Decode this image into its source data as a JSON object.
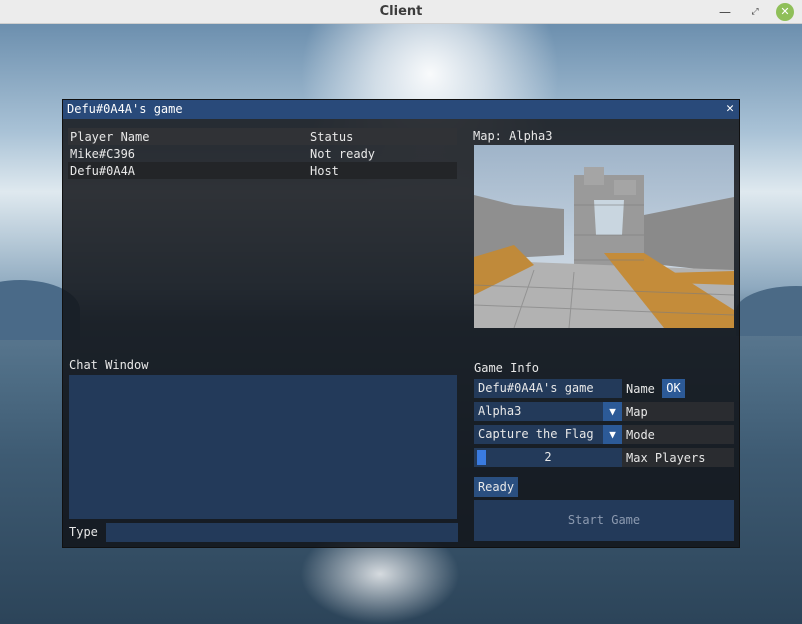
{
  "window": {
    "title": "Client"
  },
  "panel": {
    "title": "Defu#0A4A's game",
    "close_glyph": "✕"
  },
  "players": {
    "headers": [
      "Player Name",
      "Status"
    ],
    "rows": [
      {
        "name": "Mike#C396",
        "status": "Not ready"
      },
      {
        "name": "Defu#0A4A",
        "status": "Host"
      }
    ]
  },
  "map": {
    "label": "Map: Alpha3",
    "preview_icon": "map-preview"
  },
  "chat": {
    "label": "Chat Window",
    "type_label": "Type",
    "input_value": ""
  },
  "game_info": {
    "label": "Game Info",
    "name_value": "Defu#0A4A's game",
    "name_label": "Name",
    "ok_label": "OK",
    "map_value": "Alpha3",
    "map_label": "Map",
    "mode_value": "Capture the Flag",
    "mode_label": "Mode",
    "max_players_value": "2",
    "max_players_label": "Max Players",
    "ready_label": "Ready",
    "start_label": "Start Game",
    "dropdown_glyph": "▼"
  },
  "colors": {
    "accent": "#2c5a97",
    "title_bar": "#294a7a",
    "field_bg": "#233a5a"
  }
}
